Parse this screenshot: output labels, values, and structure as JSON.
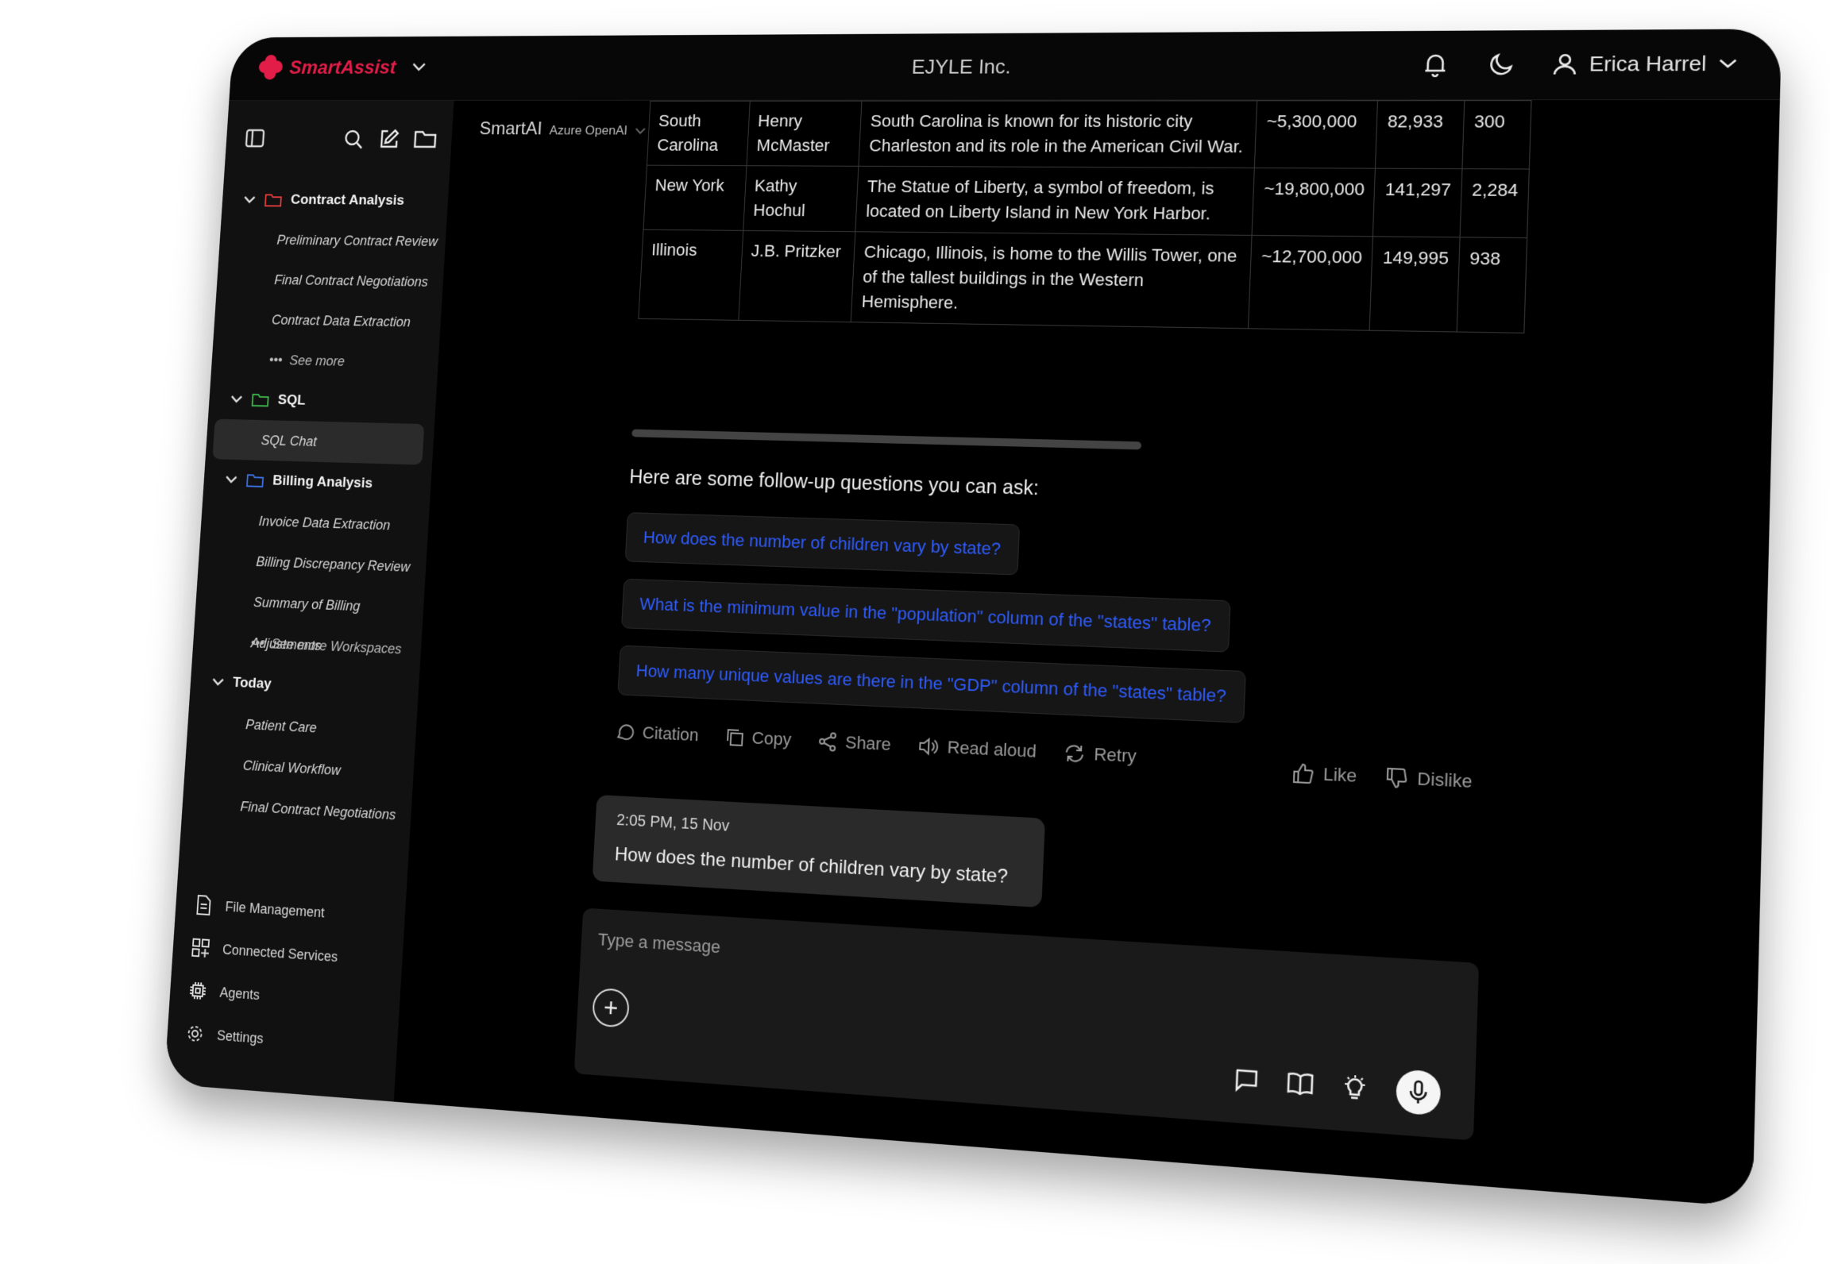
{
  "header": {
    "brand": "SmartAssist",
    "company": "EJYLE Inc.",
    "user_name": "Erica Harrel",
    "icons": [
      "bell-icon",
      "moon-icon",
      "user-icon",
      "chevron-down-icon"
    ]
  },
  "sidebar": {
    "tools": [
      "sidebar-toggle-icon",
      "search-icon",
      "edit-icon",
      "folder-icon"
    ],
    "groups": [
      {
        "label": "Contract Analysis",
        "color": "#e03b3b",
        "items": [
          "Preliminary Contract Review",
          "Final Contract Negotiations",
          "Contract Data Extraction"
        ],
        "more": "See more"
      },
      {
        "label": "SQL",
        "color": "#3bb34a",
        "items": [
          "SQL Chat"
        ],
        "active": "SQL Chat"
      },
      {
        "label": "Billing Analysis",
        "color": "#3b6ee0",
        "items": [
          "Invoice Data Extraction",
          "Billing Discrepancy Review",
          "Summary of Billing Adjustments"
        ],
        "more": "See more Workspaces"
      }
    ],
    "today": {
      "label": "Today",
      "items": [
        "Patient Care",
        "Clinical Workflow",
        "Final Contract Negotiations"
      ]
    },
    "bottom": [
      {
        "label": "File Management",
        "icon": "file-icon"
      },
      {
        "label": "Connected Services",
        "icon": "grid-plus-icon"
      },
      {
        "label": "Agents",
        "icon": "chip-icon"
      },
      {
        "label": "Settings",
        "icon": "gear-icon"
      }
    ]
  },
  "main": {
    "model": "SmartAI",
    "provider": "Azure OpenAI",
    "table": {
      "rows": [
        [
          "South Carolina",
          "Henry McMaster",
          "South Carolina is known for its historic city Charleston and its role in the American Civil War.",
          "~5,300,000",
          "82,933",
          "300"
        ],
        [
          "New York",
          "Kathy Hochul",
          "The Statue of Liberty, a symbol of freedom, is located on Liberty Island in New York Harbor.",
          "~19,800,000",
          "141,297",
          "2,284"
        ],
        [
          "Illinois",
          "J.B. Pritzker",
          "Chicago, Illinois, is home to the Willis Tower, one of the tallest buildings in the Western Hemisphere.",
          "~12,700,000",
          "149,995",
          "938"
        ]
      ]
    },
    "followup_title": "Here are some follow-up questions you can ask:",
    "followups": [
      "How does the number of children vary by state?",
      "What is the minimum value in the \"population\" column of the \"states\" table?",
      "How many unique values are there in the \"GDP\" column of the \"states\" table?"
    ],
    "actions": [
      "Citation",
      "Copy",
      "Share",
      "Read aloud",
      "Retry"
    ],
    "feedback": [
      "Like",
      "Dislike"
    ],
    "user_message": {
      "time": "2:05 PM, 15 Nov",
      "text": "How does the number of children vary by state?"
    },
    "composer": {
      "placeholder": "Type a message",
      "tools": [
        "chat-icon",
        "book-icon",
        "lightbulb-icon",
        "microphone-icon"
      ]
    }
  },
  "colors": {
    "brand": "#e11d48",
    "link": "#2f5cff",
    "background": "#000000"
  }
}
